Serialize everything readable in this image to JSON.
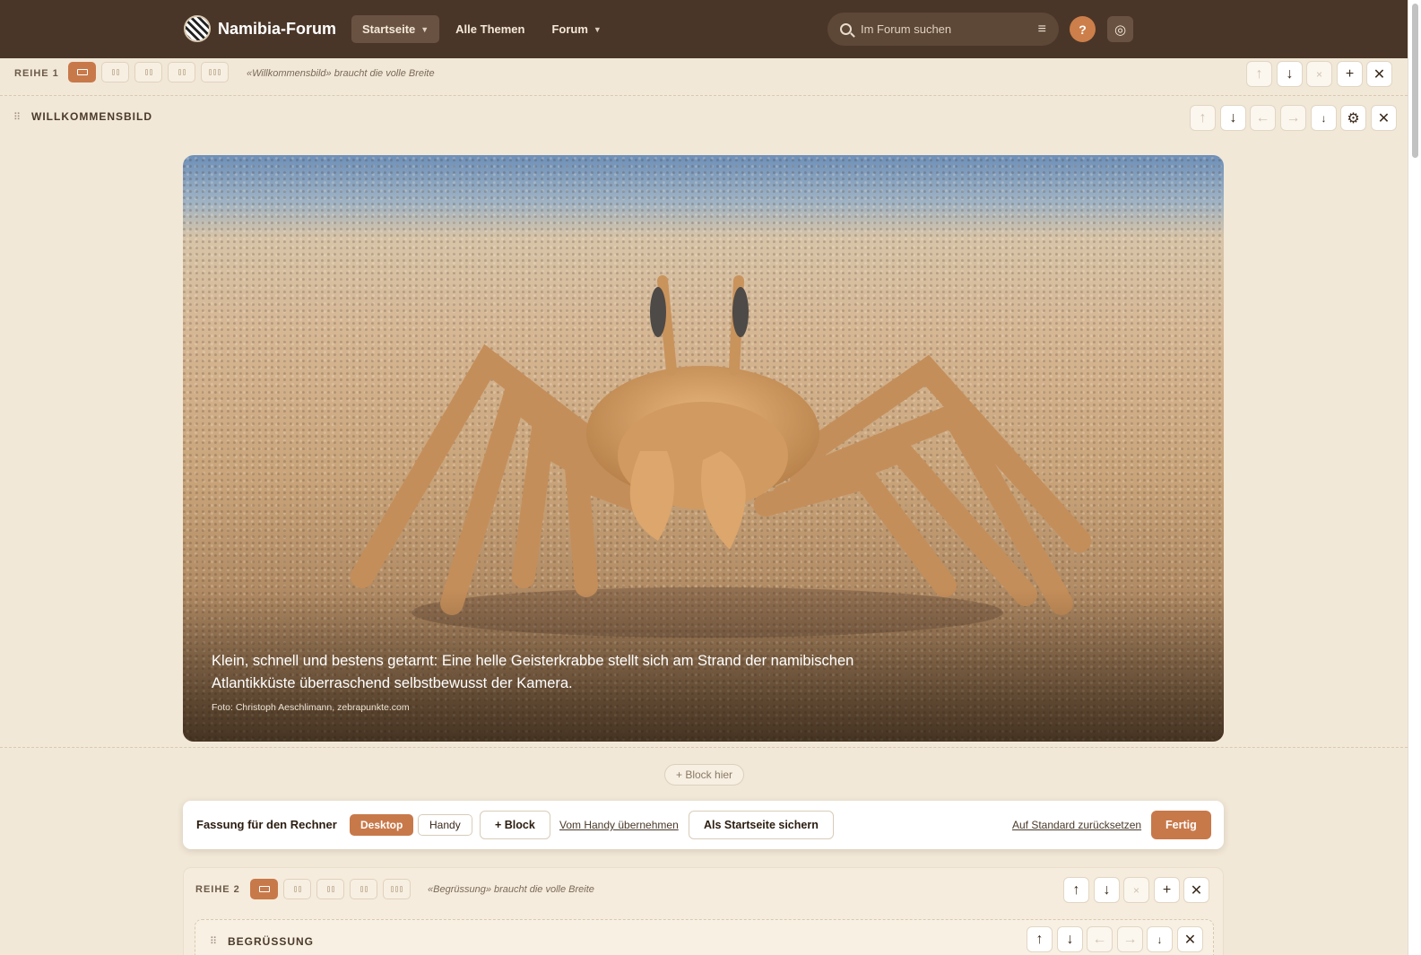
{
  "header": {
    "site_name": "Namibia-Forum",
    "nav": [
      {
        "label": "Startseite",
        "has_menu": true,
        "active": true
      },
      {
        "label": "Alle Themen",
        "has_menu": false,
        "active": false
      },
      {
        "label": "Forum",
        "has_menu": true,
        "active": false
      }
    ],
    "search_placeholder": "Im Forum suchen",
    "help_label": "?"
  },
  "row1": {
    "label": "REIHE 1",
    "note": "«Willkommensbild» braucht die volle Breite",
    "block_title": "WILLKOMMENSBILD"
  },
  "hero": {
    "caption": "Klein, schnell und bestens getarnt: Eine helle Geisterkrabbe stellt sich am Strand der namibischen Atlantikküste überraschend selbstbewusst der Kamera.",
    "credit": "Foto: Christoph Aeschlimann, zebrapunkte.com"
  },
  "add_block_here": "+ Block hier",
  "toolbar": {
    "title": "Fassung für den Rechner",
    "desktop": "Desktop",
    "mobile": "Handy",
    "add_block": "+ Block",
    "copy_from_mobile": "Vom Handy übernehmen",
    "save_as_home": "Als Startseite sichern",
    "reset": "Auf Standard zurücksetzen",
    "done": "Fertig"
  },
  "row2": {
    "label": "REIHE 2",
    "note": "«Begrüssung» braucht die volle Breite",
    "block_title": "BEGRÜSSUNG"
  },
  "colors": {
    "header_bg": "#4a3628",
    "accent": "#c8794a",
    "page_bg": "#f2e8d8"
  },
  "icons": {
    "up": "↑",
    "down": "↓",
    "left": "←",
    "right": "→",
    "x_small": "×",
    "plus": "+",
    "close": "✕",
    "gear": "⚙",
    "grip": "⠿",
    "chevron": "⌄",
    "filter": "≡",
    "palette": "◎",
    "down_small": "↓"
  }
}
